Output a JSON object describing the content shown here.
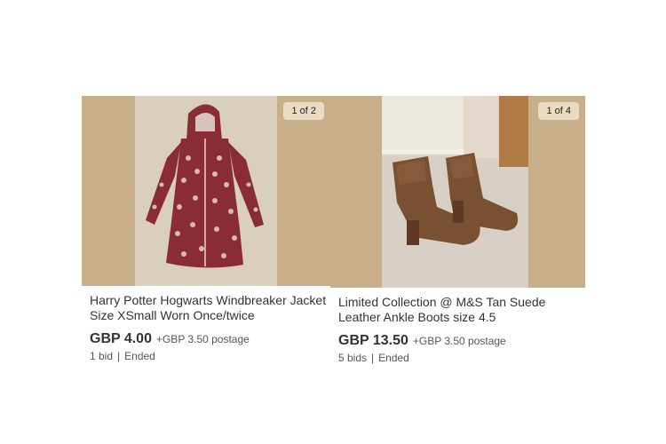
{
  "listings": [
    {
      "image_counter": "1 of 2",
      "title": "Harry Potter Hogwarts Windbreaker Jacket Size XSmall Worn Once/twice",
      "price": "GBP 4.00",
      "postage": "+GBP 3.50 postage",
      "bids": "1 bid",
      "separator": "|",
      "status": "Ended",
      "image_subject": "maroon hooded jacket with Hogwarts crest print"
    },
    {
      "image_counter": "1 of 4",
      "title": "Limited Collection @ M&S Tan Suede Leather Ankle Boots size 4.5",
      "price": "GBP 13.50",
      "postage": "+GBP 3.50 postage",
      "bids": "5 bids",
      "separator": "|",
      "status": "Ended",
      "image_subject": "pair of tan suede ankle boots on carpet"
    }
  ],
  "colors": {
    "image_side_panel": "#c9ae8a",
    "badge_bg": "#eadbc3",
    "jacket": "#8a2c33",
    "boots": "#7a5033"
  }
}
